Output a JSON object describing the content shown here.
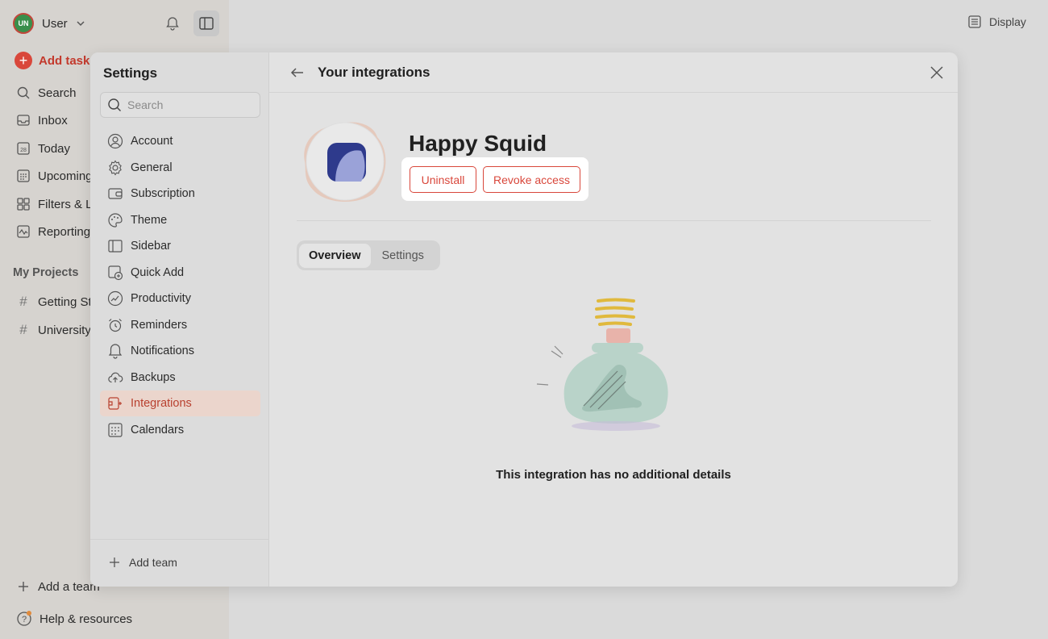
{
  "app": {
    "user_initials": "UN",
    "user_label": "User",
    "display_label": "Display",
    "add_task_label": "Add task",
    "nav": [
      {
        "label": "Search",
        "icon": "search-icon"
      },
      {
        "label": "Inbox",
        "icon": "inbox-icon"
      },
      {
        "label": "Today",
        "icon": "calendar-today-icon"
      },
      {
        "label": "Upcoming",
        "icon": "calendar-grid-icon"
      },
      {
        "label": "Filters & L",
        "icon": "filters-icon"
      },
      {
        "label": "Reporting",
        "icon": "reporting-icon"
      }
    ],
    "projects_heading": "My Projects",
    "projects": [
      {
        "label": "Getting St"
      },
      {
        "label": "University"
      }
    ],
    "add_team_label": "Add a team",
    "help_label": "Help & resources",
    "today_icon_number": "28"
  },
  "settings": {
    "title": "Settings",
    "search_placeholder": "Search",
    "menu": [
      {
        "label": "Account",
        "icon": "account-icon"
      },
      {
        "label": "General",
        "icon": "gear-icon"
      },
      {
        "label": "Subscription",
        "icon": "wallet-icon"
      },
      {
        "label": "Theme",
        "icon": "palette-icon"
      },
      {
        "label": "Sidebar",
        "icon": "sidebar-icon"
      },
      {
        "label": "Quick Add",
        "icon": "quick-add-icon"
      },
      {
        "label": "Productivity",
        "icon": "productivity-icon"
      },
      {
        "label": "Reminders",
        "icon": "alarm-icon"
      },
      {
        "label": "Notifications",
        "icon": "bell-icon"
      },
      {
        "label": "Backups",
        "icon": "cloud-upload-icon"
      },
      {
        "label": "Integrations",
        "icon": "integrations-icon",
        "active": true
      },
      {
        "label": "Calendars",
        "icon": "calendar-icon"
      }
    ],
    "add_team_label": "Add team"
  },
  "integration": {
    "header_title": "Your integrations",
    "app_name": "Happy Squid",
    "uninstall_label": "Uninstall",
    "revoke_label": "Revoke access",
    "tabs": [
      {
        "label": "Overview",
        "active": true
      },
      {
        "label": "Settings",
        "active": false
      }
    ],
    "empty_message": "This integration has no additional details"
  },
  "colors": {
    "accent": "#d9473b",
    "active_bg": "#ebd5cc",
    "logo_bg": "#2e3a8c",
    "logo_fg": "#9aa2d8"
  }
}
